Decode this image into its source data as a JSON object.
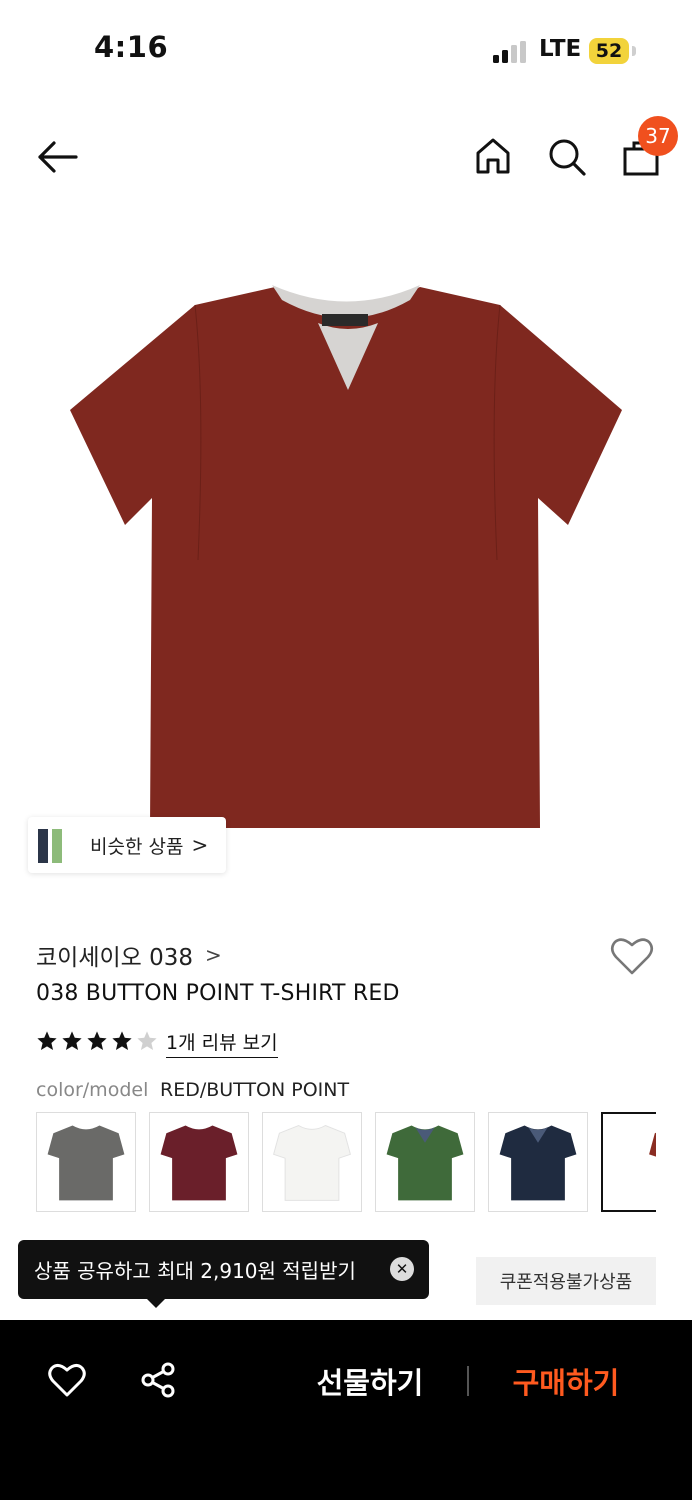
{
  "status": {
    "time": "4:16",
    "network": "LTE",
    "battery": "52"
  },
  "nav": {
    "cart_count": "37"
  },
  "similar": {
    "label": "비슷한 상품",
    "arrow": ">"
  },
  "product": {
    "brand": "코이세이오 038",
    "brand_chevron": ">",
    "title": "038 BUTTON POINT T-SHIRT RED",
    "rating": 4,
    "rating_max": 5,
    "review_link": "1개 리뷰 보기",
    "option_label": "color/model",
    "option_value": "RED/BUTTON POINT",
    "swatches": [
      {
        "name": "gray",
        "color": "#6a6a68"
      },
      {
        "name": "burgundy",
        "color": "#6a1f2a"
      },
      {
        "name": "white",
        "color": "#f4f4f2"
      },
      {
        "name": "green",
        "color": "#3f6a3a"
      },
      {
        "name": "navy",
        "color": "#1f2b40"
      },
      {
        "name": "red",
        "color": "#8a2d22"
      }
    ],
    "main_color": "#7f281f",
    "collar_color": "#d6d4d2"
  },
  "tooltip": {
    "text": "상품 공유하고 최대 2,910원 적립받기",
    "close": "✕"
  },
  "coupon": {
    "label": "쿠폰적용불가상품"
  },
  "bottom": {
    "gift": "선물하기",
    "buy": "구매하기"
  },
  "colors": {
    "accent": "#f0501e",
    "buy": "#ff5a1f"
  }
}
